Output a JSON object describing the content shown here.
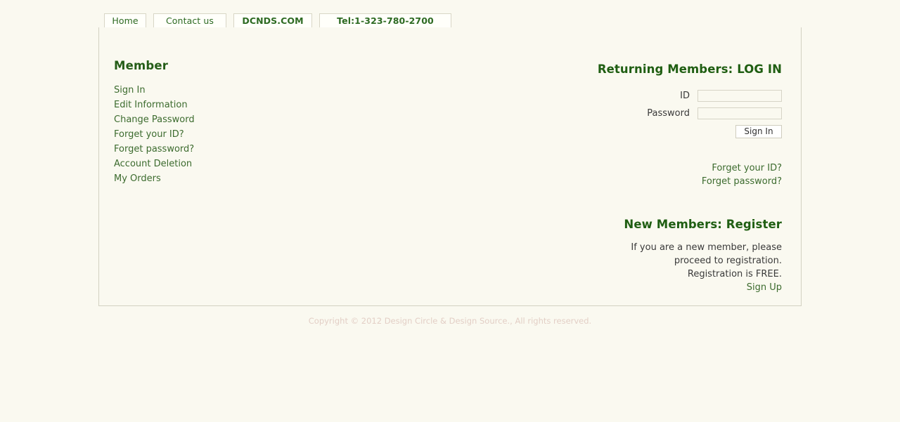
{
  "tabs": [
    {
      "label": "Home",
      "key": "home"
    },
    {
      "label": "Contact us",
      "key": "contact"
    },
    {
      "label": "DCNDS.COM",
      "key": "brand"
    },
    {
      "label": "Tel:1-323-780-2700",
      "key": "tel"
    }
  ],
  "member": {
    "title": "Member",
    "links": [
      "Sign In",
      "Edit Information",
      "Change Password",
      "Forget your ID?",
      "Forget password?",
      "Account Deletion",
      "My Orders"
    ]
  },
  "login": {
    "title": "Returning Members: LOG IN",
    "id_label": "ID",
    "id_value": "",
    "id_placeholder": "",
    "password_label": "Password",
    "password_value": "",
    "password_placeholder": "",
    "signin_button": "Sign In",
    "helper_links": [
      "Forget your ID?",
      "Forget password?"
    ]
  },
  "register": {
    "title": "New Members: Register",
    "lines": [
      "If you are a new member, please",
      "proceed to registration.",
      "Registration is FREE."
    ],
    "signup_label": "Sign Up"
  },
  "footer": {
    "copyright": "Copyright © 2012 Design Circle & Design Source., All rights reserved."
  },
  "colors": {
    "page_background": "#faf9f0",
    "heading_green": "#1f5e12",
    "link_green": "#3c6b2e",
    "tab_text_green": "#2d6a22",
    "body_text": "#3a3a3a",
    "panel_border": "#d3d1c2",
    "footer_text": "#e3cfc6",
    "input_border": "#d6d4c6",
    "button_background": "#ffffff"
  }
}
